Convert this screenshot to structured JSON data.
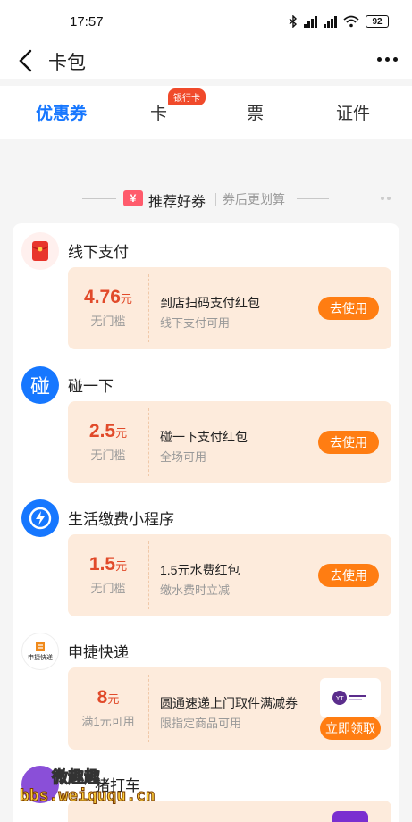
{
  "status_bar": {
    "time": "17:57",
    "battery": "92"
  },
  "header": {
    "title": "卡包"
  },
  "tabs": [
    {
      "label": "优惠券",
      "active": true
    },
    {
      "label": "卡",
      "badge": "银行卡"
    },
    {
      "label": "票"
    },
    {
      "label": "证件"
    }
  ],
  "section": {
    "title": "推荐好券",
    "subtitle": "券后更划算"
  },
  "groups": [
    {
      "merchant": "线下支付",
      "icon": "red-envelope-icon",
      "coupon": {
        "amount": "4.76",
        "unit": "元",
        "condition": "无门槛",
        "title": "到店扫码支付红包",
        "desc": "线下支付可用",
        "button": "去使用"
      }
    },
    {
      "merchant": "碰一下",
      "icon": "tap-icon",
      "icon_char": "碰",
      "coupon": {
        "amount": "2.5",
        "unit": "元",
        "condition": "无门槛",
        "title": "碰一下支付红包",
        "desc": "全场可用",
        "button": "去使用"
      }
    },
    {
      "merchant": "生活缴费小程序",
      "icon": "lightning-icon",
      "coupon": {
        "amount": "1.5",
        "unit": "元",
        "condition": "无门槛",
        "title": "1.5元水费红包",
        "desc": "缴水费时立减",
        "button": "去使用"
      }
    },
    {
      "merchant": "申捷快递",
      "icon": "express-logo-icon",
      "icon_text": "申捷快递",
      "coupon": {
        "amount": "8",
        "unit": "元",
        "condition": "满1元可用",
        "title": "圆通速递上门取件满减券",
        "desc": "限指定商品可用",
        "button": "立即领取"
      }
    }
  ],
  "partial_merchant": "猪打车",
  "watermark": {
    "line1": "微趣趣",
    "line2": "bbs.weiququ.cn"
  },
  "colors": {
    "accent": "#1677ff",
    "orange": "#ff7d12",
    "price_red": "#e14a2a",
    "coupon_bg": "#fdebdc"
  }
}
